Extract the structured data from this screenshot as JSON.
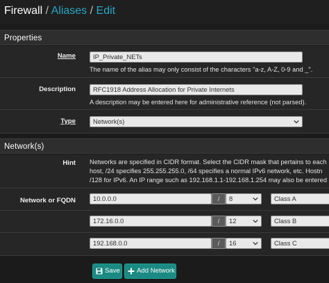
{
  "breadcrumb": {
    "root": "Firewall",
    "sep": "/",
    "aliases": "Aliases",
    "edit": "Edit"
  },
  "properties": {
    "heading": "Properties",
    "name_label": "Name",
    "name_value": "IP_Private_NETs",
    "name_help": "The name of the alias may only consist of the characters \"a-z, A-Z, 0-9 and _\".",
    "desc_label": "Description",
    "desc_value": "RFC1918 Address Allocation for Private Internets",
    "desc_help": "A description may be entered here for administrative reference (not parsed).",
    "type_label": "Type",
    "type_value": "Network(s)"
  },
  "networks": {
    "heading": "Network(s)",
    "hint_label": "Hint",
    "hint_lines": [
      "Networks are specified in CIDR format. Select the CIDR mask that pertains to each",
      "host, /24 specifies 255.255.255.0, /64 specifies a normal IPv6 network, etc. Hostn",
      "/128 for IPv6. An IP range such as 192.168.1.1-192.168.1.254 may also be entered"
    ],
    "row_label": "Network or FQDN",
    "slash": "/",
    "entries": [
      {
        "address": "10.0.0.0",
        "mask": "8",
        "description": "Class A"
      },
      {
        "address": "172.16.0.0",
        "mask": "12",
        "description": "Class B"
      },
      {
        "address": "192.168.0.0",
        "mask": "16",
        "description": "Class C"
      }
    ]
  },
  "buttons": {
    "save": "Save",
    "add_network": "Add Network"
  }
}
